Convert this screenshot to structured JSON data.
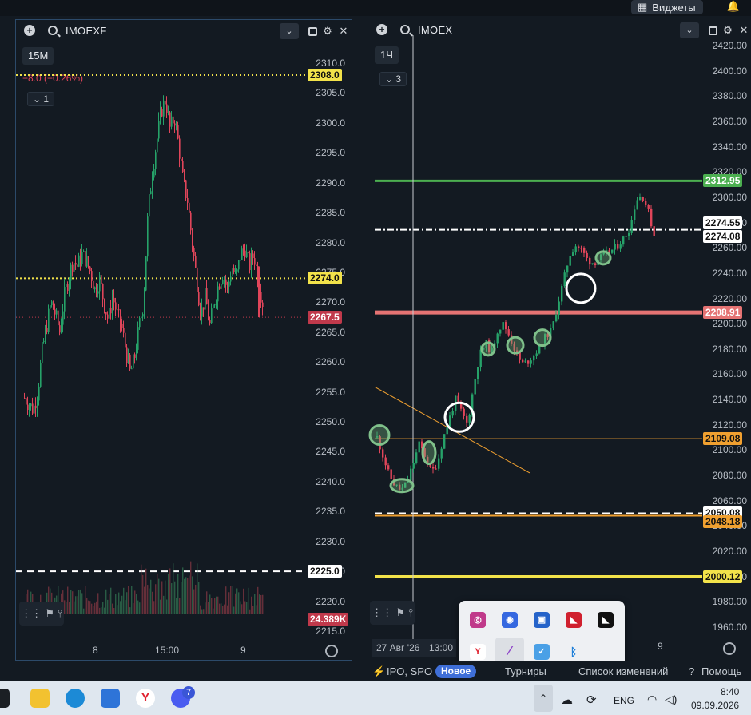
{
  "topbar": {
    "widgets_label": "Виджеты"
  },
  "left_panel": {
    "ticker": "IMOEXF",
    "timeframe": "15M",
    "change_text": "−8.0 (−0.26%)",
    "indicator_count": "1",
    "y_ticks": [
      "2310.0",
      "2305.0",
      "2300.0",
      "2295.0",
      "2290.0",
      "2285.0",
      "2280.0",
      "2275.0",
      "2270.0",
      "2265.0",
      "2260.0",
      "2255.0",
      "2250.0",
      "2245.0",
      "2240.0",
      "2235.0",
      "2230.0",
      "2225.0",
      "2220.0",
      "2215.0"
    ],
    "x_labels": [
      "8",
      "15:00",
      "9"
    ],
    "tags": {
      "top_level": "2308.0",
      "mid_level": "2274.0",
      "last_price": "2267.5",
      "dash_level": "2225.0",
      "volume": "24.389K"
    }
  },
  "right_panel": {
    "ticker": "IMOEX",
    "timeframe": "1Ч",
    "indicator_count": "3",
    "y_ticks": [
      "2420.00",
      "2400.00",
      "2380.00",
      "2360.00",
      "2340.00",
      "2320.00",
      "2300.00",
      "2280.00",
      "2260.00",
      "2240.00",
      "2220.00",
      "2200.00",
      "2180.00",
      "2160.00",
      "2140.00",
      "2120.00",
      "2100.00",
      "2080.00",
      "2060.00",
      "2040.00",
      "2020.00",
      "2000.00",
      "1980.00",
      "1960.00"
    ],
    "x_labels": [
      "27 Авг '26",
      "13:00",
      "9"
    ],
    "tags": {
      "green": "2312.95",
      "white1": "2274.55",
      "white2": "2274.08",
      "red": "2208.91",
      "orange1": "2109.08",
      "white3": "2050.08",
      "orange2": "2048.18",
      "yellow": "2000.12"
    }
  },
  "status_strip": {
    "ipo": "IPO, SPO",
    "new": "Новое",
    "tournaments": "Турниры",
    "changelog": "Список изменений",
    "help": "Помощь"
  },
  "taskbar": {
    "lang": "ENG",
    "time": "8:40",
    "date": "09.09.2026",
    "badge": "7"
  },
  "colors": {
    "up": "#26a269",
    "down": "#e0455a",
    "bg": "#131a22",
    "green_line": "#4caf50",
    "red_line": "#e57373",
    "orange_line": "#f0a030",
    "yellow_line": "#f2e24a"
  }
}
